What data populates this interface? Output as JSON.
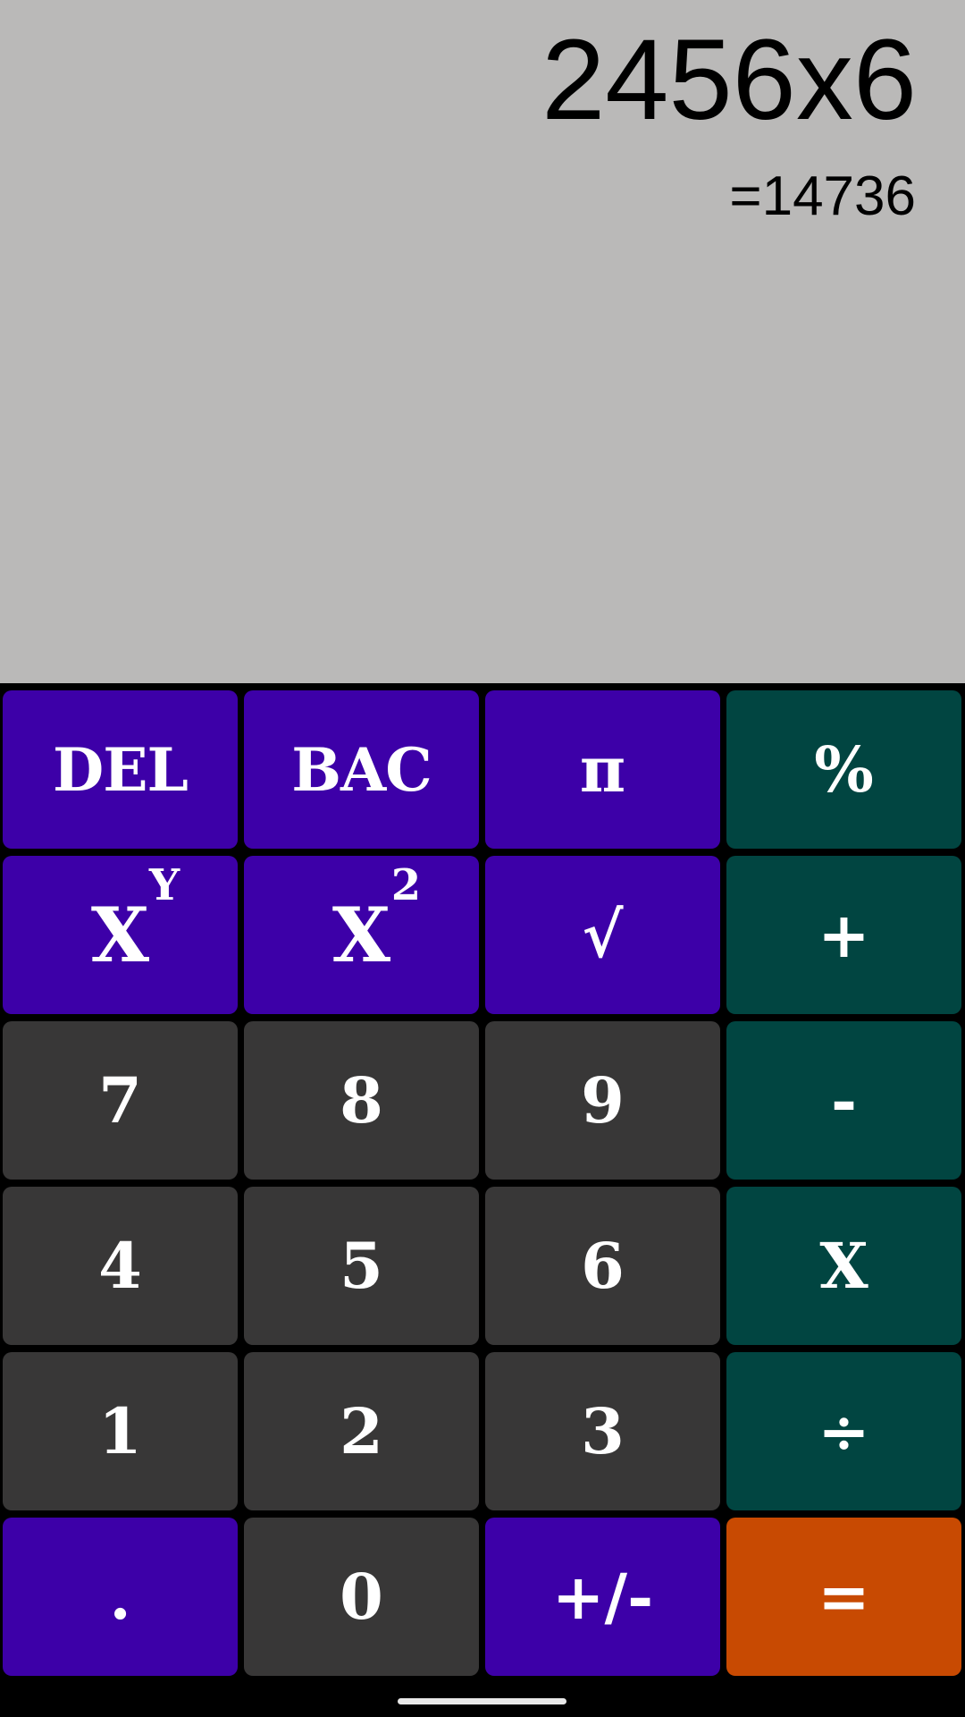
{
  "display": {
    "expression": "2456x6",
    "result": "=14736"
  },
  "keys": {
    "del": "DEL",
    "bac": "BAC",
    "pi": "π",
    "percent": "%",
    "power_base": "X",
    "power_exp": "Y",
    "square_base": "X",
    "square_exp": "2",
    "sqrt": "√",
    "plus": "+",
    "seven": "7",
    "eight": "8",
    "nine": "9",
    "minus": "-",
    "four": "4",
    "five": "5",
    "six": "6",
    "multiply": "X",
    "one": "1",
    "two": "2",
    "three": "3",
    "divide": "÷",
    "dot": ".",
    "zero": "0",
    "plus_minus": "+/-",
    "equals": "="
  },
  "colors": {
    "display_bg": "#bab9b8",
    "function_key": "#3d00a8",
    "number_key": "#383737",
    "operator_key": "#014541",
    "equals_key": "#c84a02"
  }
}
